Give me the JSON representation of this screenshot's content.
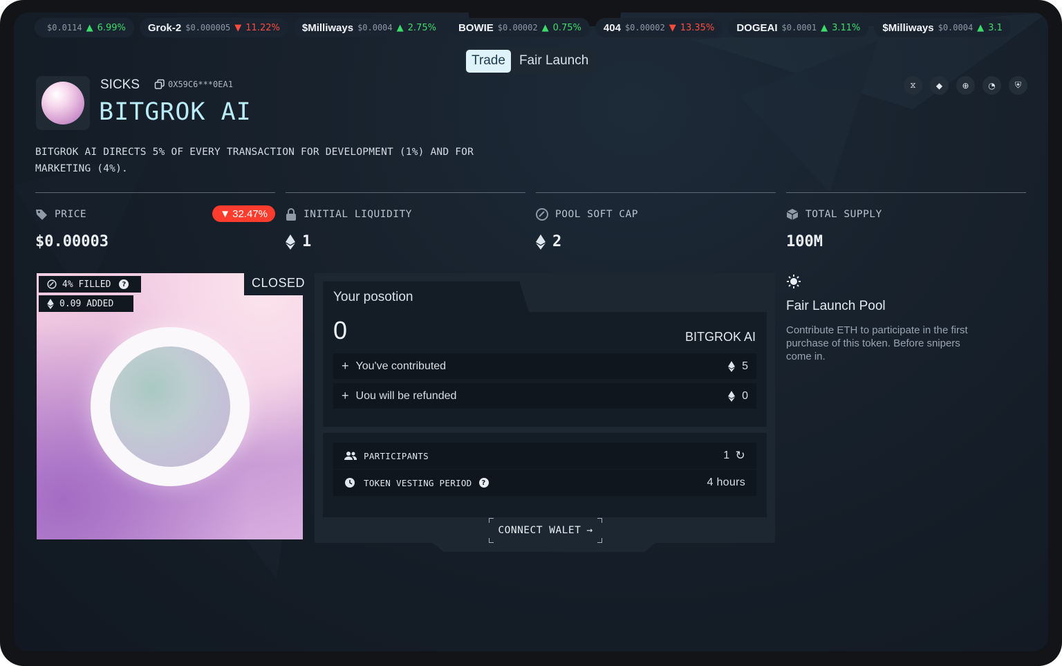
{
  "ticker": [
    {
      "name": "",
      "price": "$0.0114",
      "dir": "up",
      "change": "6.99%"
    },
    {
      "name": "Grok-2",
      "price": "$0.000005",
      "dir": "down",
      "change": "11.22%"
    },
    {
      "name": "$Milliways",
      "price": "$0.0004",
      "dir": "up",
      "change": "2.75%"
    },
    {
      "name": "BOWIE",
      "price": "$0.00002",
      "dir": "up",
      "change": "0.75%"
    },
    {
      "name": "404",
      "price": "$0.00002",
      "dir": "down",
      "change": "13.35%"
    },
    {
      "name": "DOGEAI",
      "price": "$0.0001",
      "dir": "up",
      "change": "3.11%"
    },
    {
      "name": "$Milliways",
      "price": "$0.0004",
      "dir": "up",
      "change": "3.1"
    }
  ],
  "tabs": {
    "trade": "Trade",
    "fair_launch": "Fair Launch"
  },
  "token": {
    "symbol": "SICKS",
    "address": "0X59C6***0EA1",
    "name": "BITGROK AI",
    "description": "BITGROK AI DIRECTS 5% OF EVERY TRANSACTION FOR DEVELOPMENT (1%) AND FOR MARKETING (4%)."
  },
  "stats": {
    "price_label": "PRICE",
    "price_value": "$0.00003",
    "price_change": "32.47%",
    "liquidity_label": "INITIAL LIQUIDITY",
    "liquidity_value": "1",
    "softcap_label": "POOL SOFT CAP",
    "softcap_value": "2",
    "supply_label": "TOTAL SUPPLY",
    "supply_value": "100M"
  },
  "pool_card": {
    "filled": "4% FILLED",
    "added": "0.09 ADDED",
    "status": "CLOSED"
  },
  "position": {
    "title": "Your posotion",
    "amount": "0",
    "token": "BITGROK AI",
    "contributed_label": "You've contributed",
    "contributed_value": "5",
    "refund_label": "Uou will be refunded",
    "refund_value": "0"
  },
  "info": {
    "participants_label": "PARTICIPANTS",
    "participants_value": "1",
    "vesting_label": "TOKEN VESTING PERIOD",
    "vesting_value": "4 hours"
  },
  "connect_label": "CONNECT WALET",
  "fair_launch_info": {
    "title": "Fair Launch Pool",
    "description": "Contribute ETH to participate in the first purchase of this token. Before snipers come in."
  },
  "colors": {
    "up": "#3ddc6a",
    "down": "#ff4b3e",
    "accent": "#b9ecf7",
    "badge": "#ff3c2e"
  }
}
